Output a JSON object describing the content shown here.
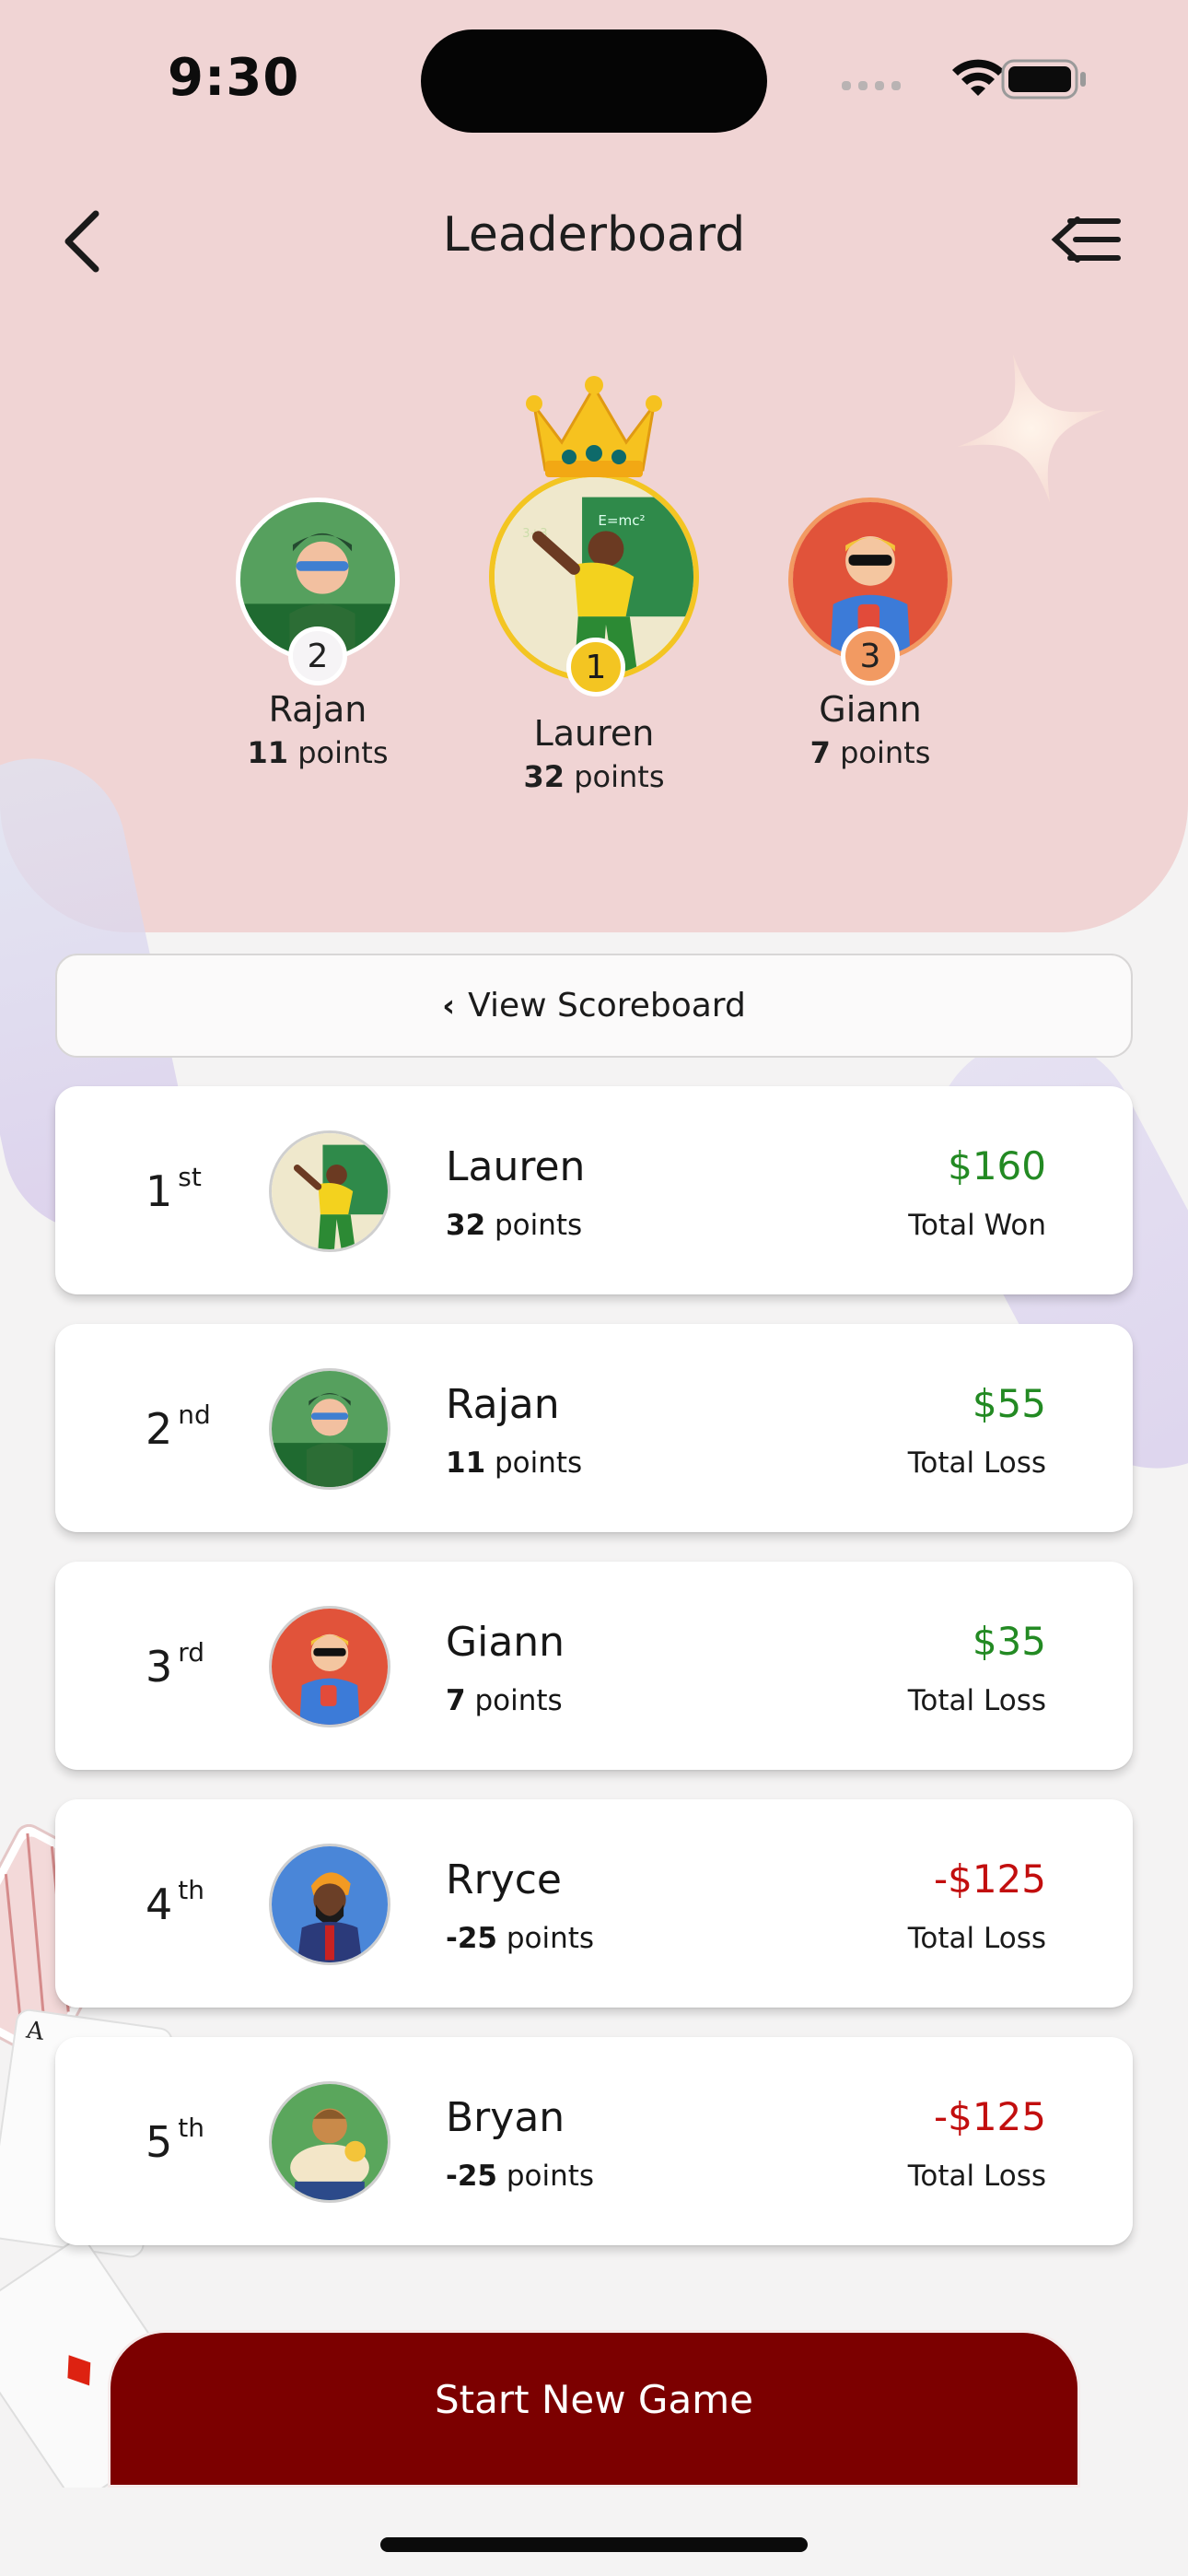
{
  "status_bar": {
    "time": "9:30"
  },
  "header": {
    "title": "Leaderboard"
  },
  "podium": [
    {
      "rank": "2",
      "name": "Rajan",
      "points": "11",
      "points_label": "points"
    },
    {
      "rank": "1",
      "name": "Lauren",
      "points": "32",
      "points_label": "points"
    },
    {
      "rank": "3",
      "name": "Giann",
      "points": "7",
      "points_label": "points"
    }
  ],
  "view_scoreboard": {
    "chevron": "‹",
    "label": "View Scoreboard"
  },
  "leaderboard": [
    {
      "place": "1",
      "suffix": "st",
      "name": "Lauren",
      "points": "32",
      "points_label": "points",
      "amount": "$160",
      "result": "Total Won"
    },
    {
      "place": "2",
      "suffix": "nd",
      "name": "Rajan",
      "points": "11",
      "points_label": "points",
      "amount": "$55",
      "result": "Total Loss"
    },
    {
      "place": "3",
      "suffix": "rd",
      "name": "Giann",
      "points": "7",
      "points_label": "points",
      "amount": "$35",
      "result": "Total Loss"
    },
    {
      "place": "4",
      "suffix": "th",
      "name": "Rryce",
      "points": "-25",
      "points_label": "points",
      "amount": "-$125",
      "result": "Total Loss"
    },
    {
      "place": "5",
      "suffix": "th",
      "name": "Bryan",
      "points": "-25",
      "points_label": "points",
      "amount": "-$125",
      "result": "Total Loss"
    }
  ],
  "cta": {
    "label": "Start New Game"
  },
  "colors": {
    "accent": "#7c0000",
    "header_bg": "#f0d4d4",
    "won": "#238a23",
    "loss": "#c20e0e",
    "gold": "#f3c522",
    "bronze": "#f29a62"
  }
}
